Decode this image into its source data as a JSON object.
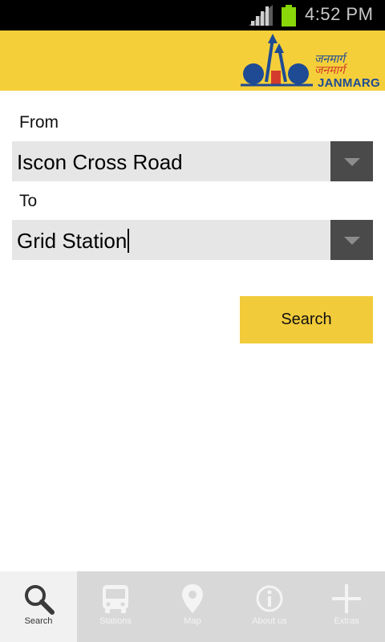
{
  "status_bar": {
    "time": "4:52 PM",
    "signal_icon": "signal-icon",
    "battery_icon": "battery-icon"
  },
  "header": {
    "logo": {
      "hindi_line_1": "जनमार्ग",
      "hindi_line_2": "जनमार्ग",
      "name": "JANMARG"
    }
  },
  "form": {
    "from_label": "From",
    "from_value": "Iscon Cross Road",
    "to_label": "To",
    "to_value": "Grid Station",
    "search_label": "Search"
  },
  "tabs": [
    {
      "label": "Search",
      "icon": "magnifier-icon",
      "active": true
    },
    {
      "label": "Stations",
      "icon": "bus-icon",
      "active": false
    },
    {
      "label": "Map",
      "icon": "map-pin-icon",
      "active": false
    },
    {
      "label": "About us",
      "icon": "info-icon",
      "active": false
    },
    {
      "label": "Extras",
      "icon": "plus-icon",
      "active": false
    }
  ],
  "colors": {
    "header": "#f5cf3a",
    "button": "#f2cb3a",
    "tabbar": "#d8d8d8",
    "active_tab": "#f1f1f1"
  }
}
